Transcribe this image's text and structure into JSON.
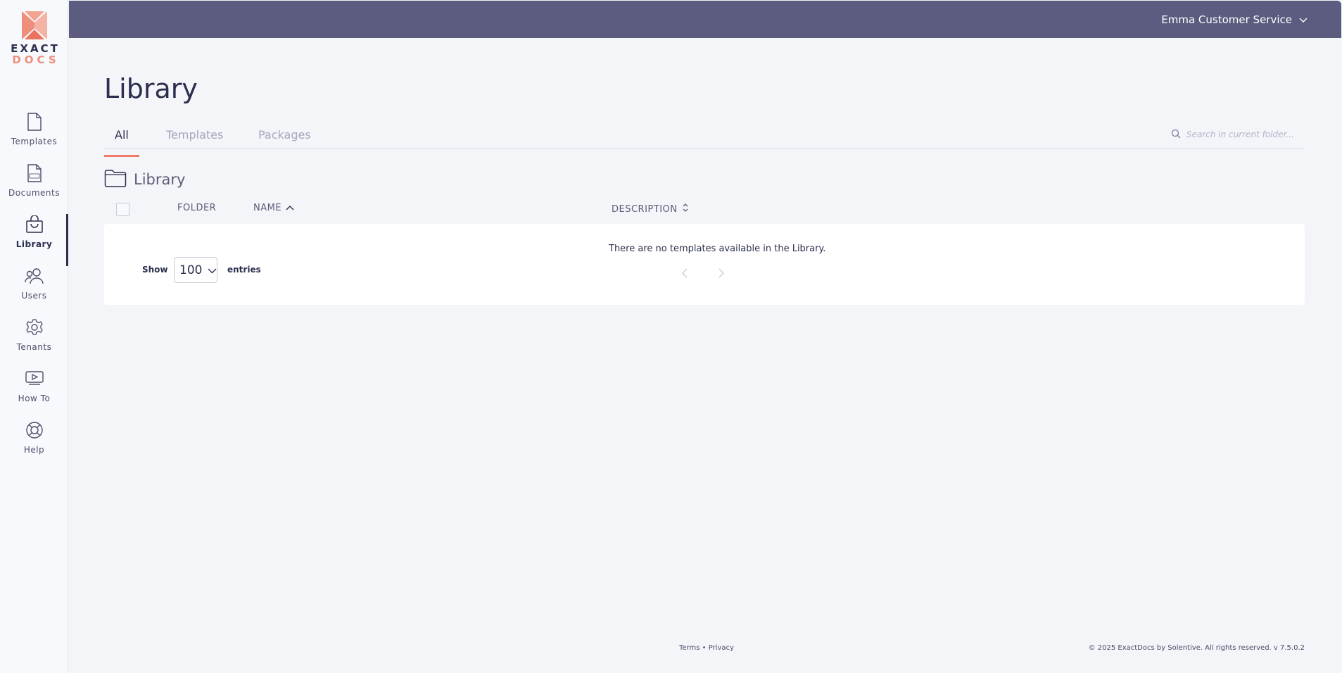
{
  "brand": {
    "logo_top": "EXACT",
    "logo_bottom": "DOCS",
    "accent_color": "#ee7a67",
    "header_color": "#5b5c7f"
  },
  "sidebar": {
    "items": [
      {
        "label": "Templates",
        "icon": "file-icon"
      },
      {
        "label": "Documents",
        "icon": "doc-file-icon"
      },
      {
        "label": "Library",
        "icon": "shopping-bag-icon",
        "active": true
      },
      {
        "label": "Users",
        "icon": "users-icon"
      },
      {
        "label": "Tenants",
        "icon": "gear-icon"
      },
      {
        "label": "How To",
        "icon": "video-icon"
      },
      {
        "label": "Help",
        "icon": "lifebuoy-icon"
      }
    ]
  },
  "header": {
    "user_name": "Emma Customer Service"
  },
  "main": {
    "title": "Library",
    "tabs": [
      {
        "label": "All",
        "active": true
      },
      {
        "label": "Templates"
      },
      {
        "label": "Packages"
      }
    ],
    "search_placeholder": "Search in current folder...",
    "folder_name": "Library",
    "columns": {
      "folder": "FOLDER",
      "name": "NAME",
      "description": "DESCRIPTION"
    },
    "empty_message": "There are no templates available in the Library.",
    "show_label": "Show",
    "entries_value": "100",
    "entries_label": "entries"
  },
  "footer": {
    "terms": "Terms",
    "separator": "•",
    "privacy": "Privacy",
    "copyright": "© 2025 ExactDocs by Solentive. All rights reserved. v 7.5.0.2"
  }
}
